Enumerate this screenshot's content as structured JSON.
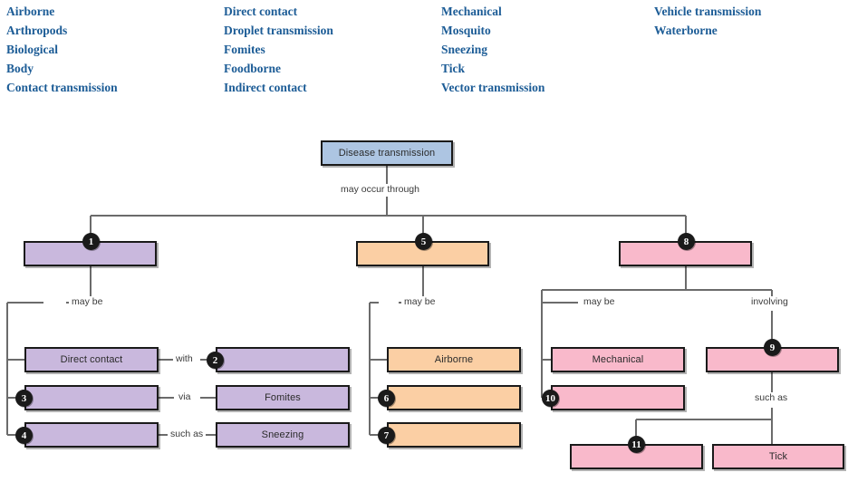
{
  "word_bank": {
    "columns": [
      {
        "terms": [
          "Airborne",
          "Arthropods",
          "Biological",
          "Body",
          "Contact transmission"
        ]
      },
      {
        "terms": [
          "Direct contact",
          "Droplet transmission",
          "Fomites",
          "Foodborne",
          "Indirect contact"
        ]
      },
      {
        "terms": [
          "Mechanical",
          "Mosquito",
          "Sneezing",
          "Tick",
          "Vector transmission"
        ]
      },
      {
        "terms": [
          "Vehicle transmission",
          "Waterborne"
        ]
      }
    ]
  },
  "colors": {
    "word_bank_text": "#1c5c96",
    "root_fill": "#adc5e2",
    "purple_fill": "#c9b8dd",
    "orange_fill": "#fbcfa4",
    "pink_fill": "#f9b9cb",
    "border": "#1a1a1a",
    "badge_bg": "#1a1a1a",
    "badge_text": "#ffffff"
  },
  "diagram": {
    "root": {
      "label": "Disease transmission"
    },
    "edge_labels": {
      "root_to_branches": "may occur through",
      "purple_may_be": "may be",
      "orange_may_be": "may be",
      "pink_may_be": "may be",
      "pink_involving": "involving",
      "node9_such_as": "such as",
      "row1_with": "with",
      "row2_via": "via",
      "row3_such_as": "such as"
    },
    "branches": {
      "purple": {
        "node": {
          "badge": "1",
          "label": ""
        },
        "rows": [
          {
            "left": {
              "badge": "",
              "label": "Direct contact"
            },
            "connector": "with",
            "right": {
              "badge": "2",
              "label": ""
            }
          },
          {
            "left": {
              "badge": "3",
              "label": ""
            },
            "connector": "via",
            "right": {
              "badge": "",
              "label": "Fomites"
            }
          },
          {
            "left": {
              "badge": "4",
              "label": ""
            },
            "connector": "such as",
            "right": {
              "badge": "",
              "label": "Sneezing"
            }
          }
        ]
      },
      "orange": {
        "node": {
          "badge": "5",
          "label": ""
        },
        "rows": [
          {
            "badge": "",
            "label": "Airborne"
          },
          {
            "badge": "6",
            "label": ""
          },
          {
            "badge": "7",
            "label": ""
          }
        ]
      },
      "pink": {
        "node": {
          "badge": "8",
          "label": ""
        },
        "may_be_rows": [
          {
            "badge": "",
            "label": "Mechanical"
          },
          {
            "badge": "10",
            "label": ""
          }
        ],
        "involving": {
          "badge": "9",
          "label": ""
        },
        "such_as_rows": [
          {
            "badge": "11",
            "label": ""
          },
          {
            "badge": "",
            "label": "Tick"
          }
        ]
      }
    }
  }
}
